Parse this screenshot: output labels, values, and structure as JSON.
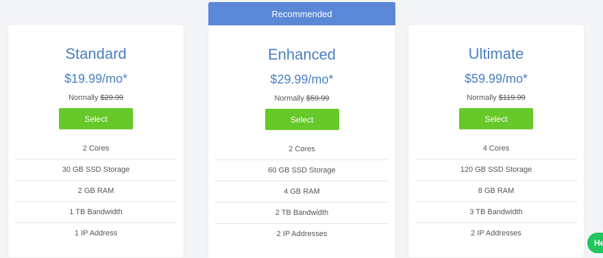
{
  "recommended_label": "Recommended",
  "plans": [
    {
      "name": "Standard",
      "price": "$19.99/mo*",
      "normally_label": "Normally",
      "normal_price": "$29.99",
      "select_label": "Select",
      "features": [
        "2 Cores",
        "30 GB SSD Storage",
        "2 GB RAM",
        "1 TB Bandwidth",
        "1 IP Address"
      ]
    },
    {
      "name": "Enhanced",
      "price": "$29.99/mo*",
      "normally_label": "Normally",
      "normal_price": "$59.99",
      "select_label": "Select",
      "features": [
        "2 Cores",
        "60 GB SSD Storage",
        "4 GB RAM",
        "2 TB Bandwidth",
        "2 IP Addresses"
      ]
    },
    {
      "name": "Ultimate",
      "price": "$59.99/mo*",
      "normally_label": "Normally",
      "normal_price": "$119.99",
      "select_label": "Select",
      "features": [
        "4 Cores",
        "120 GB SSD Storage",
        "8 GB RAM",
        "3 TB Bandwidth",
        "2 IP Addresses"
      ]
    }
  ],
  "chat_widget": {
    "label": "He"
  },
  "colors": {
    "accent_blue": "#4a7fc1",
    "banner_blue": "#5a88d6",
    "button_green": "#67c82a"
  }
}
